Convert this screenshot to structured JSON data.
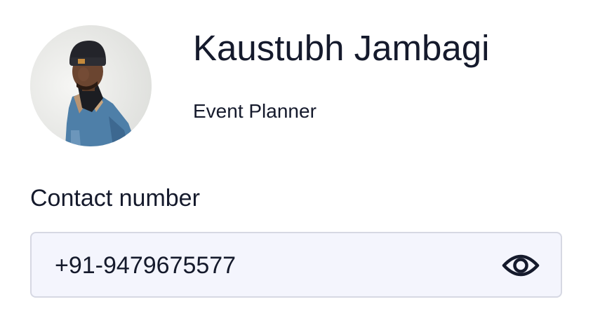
{
  "profile": {
    "name": "Kaustubh Jambagi",
    "role": "Event Planner"
  },
  "contact": {
    "label": "Contact number",
    "value": "+91-9479675577",
    "visibility_icon": "eye-icon"
  },
  "colors": {
    "text": "#151a2c",
    "input_background": "#f4f5fd",
    "input_border": "#d6d8e3"
  }
}
